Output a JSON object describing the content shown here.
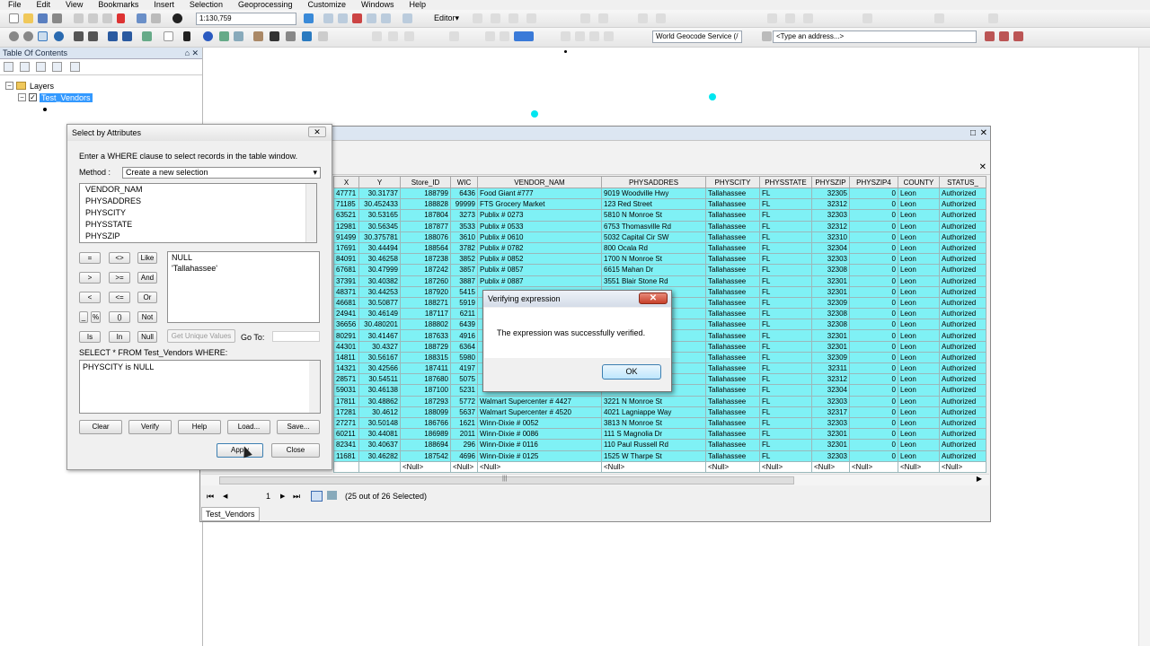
{
  "menu": [
    "File",
    "Edit",
    "View",
    "Bookmarks",
    "Insert",
    "Selection",
    "Geoprocessing",
    "Customize",
    "Windows",
    "Help"
  ],
  "toolbar": {
    "scale": "1:130,759",
    "editor_label": "Editor▾",
    "geocode_service": "World Geocode Service (/",
    "address_placeholder": "<Type an address...>"
  },
  "toc": {
    "title": "Table Of Contents",
    "pin": "⌂",
    "close": "✕",
    "root_label": "Layers",
    "layer_label": "Test_Vendors"
  },
  "table": {
    "tab_label": "Test_Vendors",
    "columns": [
      "X",
      "Y",
      "Store_ID",
      "WIC",
      "VENDOR_NAM",
      "PHYSADDRES",
      "PHYSCITY",
      "PHYSSTATE",
      "PHYSZIP",
      "PHYSZIP4",
      "COUNTY",
      "STATUS_"
    ],
    "rows": [
      [
        "47771",
        "30.31737",
        "188799",
        "6436",
        "Food Giant #777",
        "9019 Woodville Hwy",
        "Tallahassee",
        "FL",
        "32305",
        "0",
        "Leon",
        "Authorized"
      ],
      [
        "71185",
        "30.452433",
        "188828",
        "99999",
        "FTS Grocery Market",
        "123 Red Street",
        "Tallahassee",
        "FL",
        "32312",
        "0",
        "Leon",
        "Authorized"
      ],
      [
        "63521",
        "30.53165",
        "187804",
        "3273",
        "Publix # 0273",
        "5810 N Monroe St",
        "Tallahassee",
        "FL",
        "32303",
        "0",
        "Leon",
        "Authorized"
      ],
      [
        "12981",
        "30.56345",
        "187877",
        "3533",
        "Publix # 0533",
        "6753 Thomasville Rd",
        "Tallahassee",
        "FL",
        "32312",
        "0",
        "Leon",
        "Authorized"
      ],
      [
        "91499",
        "30.375781",
        "188076",
        "3610",
        "Publix # 0610",
        "5032 Capital Cir SW",
        "Tallahassee",
        "FL",
        "32310",
        "0",
        "Leon",
        "Authorized"
      ],
      [
        "17691",
        "30.44494",
        "188564",
        "3782",
        "Publix # 0782",
        "800 Ocala Rd",
        "Tallahassee",
        "FL",
        "32304",
        "0",
        "Leon",
        "Authorized"
      ],
      [
        "84091",
        "30.46258",
        "187238",
        "3852",
        "Publix # 0852",
        "1700 N Monroe St",
        "Tallahassee",
        "FL",
        "32303",
        "0",
        "Leon",
        "Authorized"
      ],
      [
        "67681",
        "30.47999",
        "187242",
        "3857",
        "Publix # 0857",
        "6615 Mahan Dr",
        "Tallahassee",
        "FL",
        "32308",
        "0",
        "Leon",
        "Authorized"
      ],
      [
        "37391",
        "30.40382",
        "187260",
        "3887",
        "Publix # 0887",
        "3551 Blair Stone Rd",
        "Tallahassee",
        "FL",
        "32301",
        "0",
        "Leon",
        "Authorized"
      ],
      [
        "48371",
        "30.44253",
        "187920",
        "5415",
        "",
        "",
        "Tallahassee",
        "FL",
        "32301",
        "0",
        "Leon",
        "Authorized"
      ],
      [
        "46681",
        "30.50877",
        "188271",
        "5919",
        "",
        "",
        "Tallahassee",
        "FL",
        "32309",
        "0",
        "Leon",
        "Authorized"
      ],
      [
        "24941",
        "30.46149",
        "187117",
        "6211",
        "",
        "",
        "Tallahassee",
        "FL",
        "32308",
        "0",
        "Leon",
        "Authorized"
      ],
      [
        "36656",
        "30.480201",
        "188802",
        "6439",
        "",
        "e",
        "Tallahassee",
        "FL",
        "32308",
        "0",
        "Leon",
        "Authorized"
      ],
      [
        "80291",
        "30.41467",
        "187633",
        "4916",
        "",
        "",
        "Tallahassee",
        "FL",
        "32301",
        "0",
        "Leon",
        "Authorized"
      ],
      [
        "44301",
        "30.4327",
        "188729",
        "6364",
        "",
        "vy",
        "Tallahassee",
        "FL",
        "32301",
        "0",
        "Leon",
        "Authorized"
      ],
      [
        "14811",
        "30.56167",
        "188315",
        "5980",
        "",
        "d",
        "Tallahassee",
        "FL",
        "32309",
        "0",
        "Leon",
        "Authorized"
      ],
      [
        "14321",
        "30.42566",
        "187411",
        "4197",
        "",
        "d",
        "Tallahassee",
        "FL",
        "32311",
        "0",
        "Leon",
        "Authorized"
      ],
      [
        "28571",
        "30.54511",
        "187680",
        "5075",
        "",
        "",
        "Tallahassee",
        "FL",
        "32312",
        "0",
        "Leon",
        "Authorized"
      ],
      [
        "59031",
        "30.46138",
        "187100",
        "5231",
        "",
        "St",
        "Tallahassee",
        "FL",
        "32304",
        "0",
        "Leon",
        "Authorized"
      ],
      [
        "17811",
        "30.48862",
        "187293",
        "5772",
        "Walmart Supercenter # 4427",
        "3221 N Monroe St",
        "Tallahassee",
        "FL",
        "32303",
        "0",
        "Leon",
        "Authorized"
      ],
      [
        "17281",
        "30.4612",
        "188099",
        "5637",
        "Walmart Supercenter # 4520",
        "4021 Lagniappe Way",
        "Tallahassee",
        "FL",
        "32317",
        "0",
        "Leon",
        "Authorized"
      ],
      [
        "27271",
        "30.50148",
        "186766",
        "1621",
        "Winn-Dixie # 0052",
        "3813 N Monroe St",
        "Tallahassee",
        "FL",
        "32303",
        "0",
        "Leon",
        "Authorized"
      ],
      [
        "60211",
        "30.44081",
        "186989",
        "2011",
        "Winn-Dixie # 0086",
        "111 S Magnolia Dr",
        "Tallahassee",
        "FL",
        "32301",
        "0",
        "Leon",
        "Authorized"
      ],
      [
        "82341",
        "30.40637",
        "188694",
        "296",
        "Winn-Dixie # 0116",
        "110 Paul Russell Rd",
        "Tallahassee",
        "FL",
        "32301",
        "0",
        "Leon",
        "Authorized"
      ],
      [
        "11681",
        "30.46282",
        "187542",
        "4696",
        "Winn-Dixie # 0125",
        "1525 W Tharpe St",
        "Tallahassee",
        "FL",
        "32303",
        "0",
        "Leon",
        "Authorized"
      ]
    ],
    "null_row": [
      "",
      "",
      "<Null>",
      "<Null>",
      "<Null>",
      "<Null>",
      "<Null>",
      "<Null>",
      "<Null>",
      "<Null>",
      "<Null>",
      "<Null>"
    ],
    "nav": {
      "first": "⏮",
      "prev": "◀",
      "current": "1",
      "next": "▶",
      "last": "⏭",
      "selected_text": "(25 out of 26 Selected)"
    },
    "hscroll_left": "◀",
    "hscroll_right": "▶",
    "hscroll_grip": "|||",
    "restore": "□",
    "close": "✕",
    "subclose": "✕"
  },
  "sba": {
    "title": "Select by Attributes",
    "close": "✕",
    "description": "Enter a WHERE clause to select records in the table window.",
    "method_label": "Method :",
    "method_value": "Create a new selection",
    "fields": [
      "VENDOR_NAM",
      "PHYSADDRES",
      "PHYSCITY",
      "PHYSSTATE",
      "PHYSZIP"
    ],
    "ops": [
      "=",
      "<>",
      "Like",
      ">",
      ">=",
      "And",
      "<",
      "<=",
      "Or",
      "_",
      "%",
      "()",
      "Not",
      "Is",
      "In",
      "Null"
    ],
    "values": [
      "NULL",
      "'Tallahassee'"
    ],
    "get_unique": "Get Unique Values",
    "goto_label": "Go To:",
    "sql_label": "SELECT * FROM Test_Vendors WHERE:",
    "sql_text": "PHYSCITY is NULL",
    "buttons": {
      "clear": "Clear",
      "verify": "Verify",
      "help": "Help",
      "load": "Load...",
      "save": "Save...",
      "apply": "Apply",
      "close": "Close"
    }
  },
  "verify_dialog": {
    "title": "Verifying expression",
    "close": "✕",
    "message": "The expression was successfully verified.",
    "ok": "OK"
  }
}
